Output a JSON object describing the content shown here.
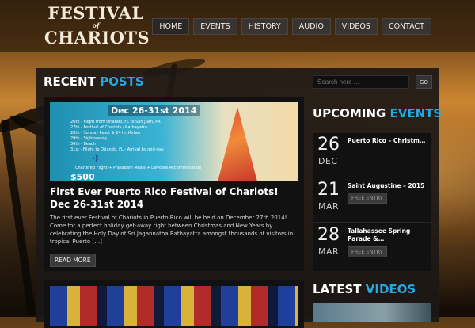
{
  "logo": {
    "line1": "FESTIVAL",
    "line2": "of",
    "line3": "CHARIOTS"
  },
  "nav": {
    "items": [
      "HOME",
      "EVENTS",
      "HISTORY",
      "AUDIO",
      "VIDEOS",
      "CONTACT"
    ]
  },
  "search": {
    "placeholder": "Search here ...",
    "button_label": "GO"
  },
  "recent_posts": {
    "title_main": "RECENT",
    "title_accent": "POSTS"
  },
  "post": {
    "banner_date": "Dec 26-31st 2014",
    "banner_schedule": "26th - Flight from Orlando, FL to San Juan, PR\n27th - Festival of Chariots / Rathayatra\n28th - Sunday Feast & 24 hr. Kirtan\n29th - Sightseeing\n30th - Beach\n31st - Flight to Orlando, FL - Arrival by mid-day",
    "banner_offer": "Chartered Flight + Prasadam Meals + Devotee Accommodation",
    "banner_price": "$500",
    "title": "First Ever Puerto Rico Festival of Chariots! Dec 26-31st 2014",
    "excerpt": "The first ever Festival of Chariots in Puerto Rico will be held on December 27th 2014! Come for a perfect holiday get-away right between Christmas and New Years by celebrating the Holy Day of Sri Jagannatha Rathayatra amongst thousands of visitors in tropical Puerto […]",
    "read_more": "READ MORE"
  },
  "upcoming_events": {
    "title_main": "UPCOMING",
    "title_accent": "EVENTS",
    "items": [
      {
        "day": "26",
        "month": "DEC",
        "title": "Puerto Rico – Christm…",
        "badge": ""
      },
      {
        "day": "21",
        "month": "MAR",
        "title": "Saint Augustine – 2015",
        "badge": "FREE ENTRY"
      },
      {
        "day": "28",
        "month": "MAR",
        "title": "Tallahassee Spring Parade &…",
        "badge": "FREE ENTRY"
      }
    ]
  },
  "latest_videos": {
    "title_main": "LATEST",
    "title_accent": "VIDEOS"
  },
  "colors": {
    "accent": "#29a7de",
    "panel": "#1c1816",
    "card": "#111111"
  }
}
